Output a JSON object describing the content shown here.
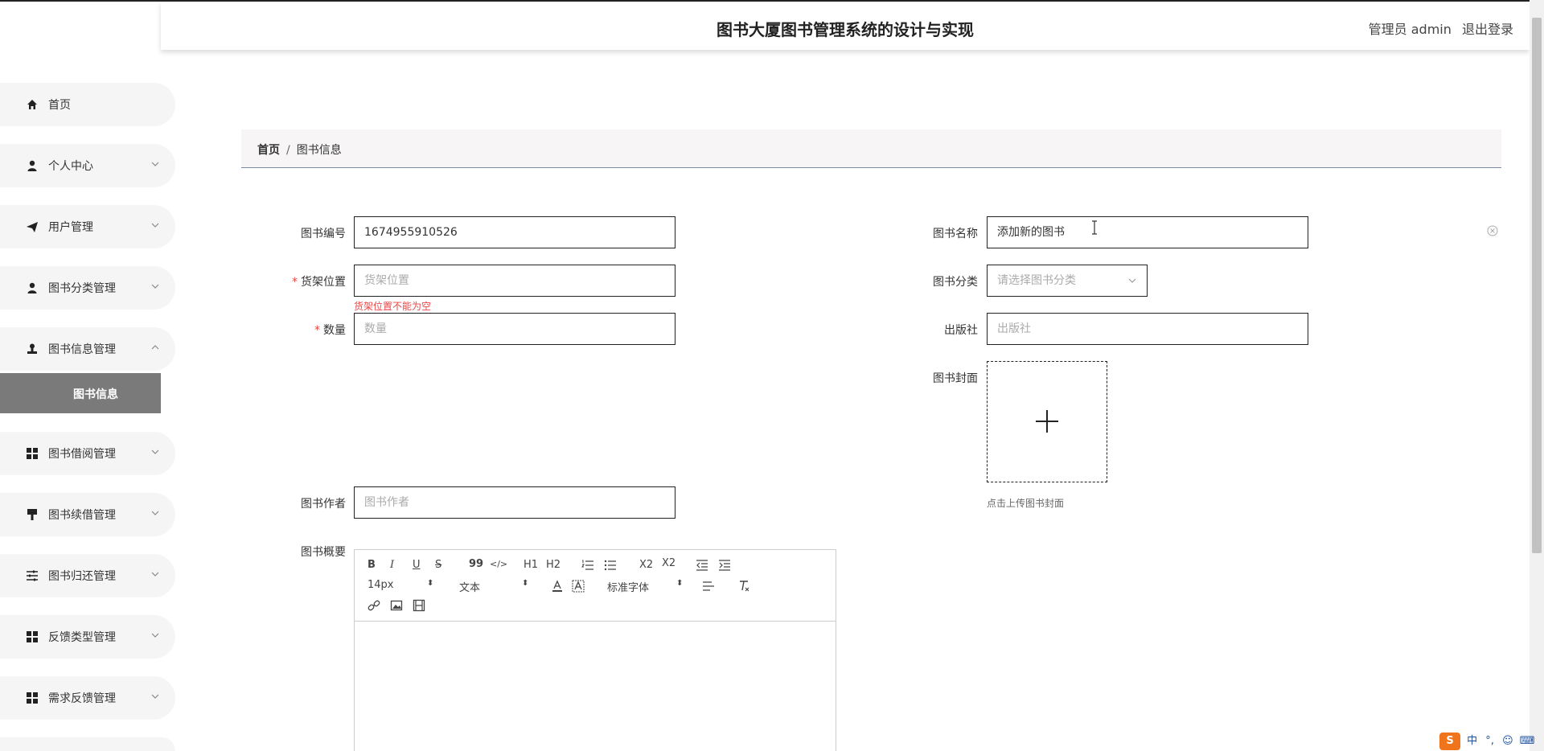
{
  "header": {
    "title": "图书大厦图书管理系统的设计与实现",
    "user_label": "管理员 admin",
    "logout_label": "退出登录"
  },
  "sidebar": {
    "items": [
      {
        "label": "首页",
        "icon": "home-icon"
      },
      {
        "label": "个人中心",
        "icon": "person-icon"
      },
      {
        "label": "用户管理",
        "icon": "send-icon"
      },
      {
        "label": "图书分类管理",
        "icon": "person-icon"
      },
      {
        "label": "图书信息管理",
        "icon": "stamp-icon"
      },
      {
        "label": "图书借阅管理",
        "icon": "grid-icon"
      },
      {
        "label": "图书续借管理",
        "icon": "brush-icon"
      },
      {
        "label": "图书归还管理",
        "icon": "sliders-icon"
      },
      {
        "label": "反馈类型管理",
        "icon": "grid-icon"
      },
      {
        "label": "需求反馈管理",
        "icon": "grid-icon"
      }
    ],
    "active_sub": "图书信息"
  },
  "breadcrumb": {
    "home": "首页",
    "separator": "/",
    "current": "图书信息"
  },
  "form": {
    "book_no": {
      "label": "图书编号",
      "value": "1674955910526"
    },
    "book_name": {
      "label": "图书名称",
      "value": "添加新的图书"
    },
    "shelf": {
      "label": "货架位置",
      "placeholder": "货架位置",
      "error": "货架位置不能为空",
      "required": "*"
    },
    "category": {
      "label": "图书分类",
      "placeholder": "请选择图书分类"
    },
    "quantity": {
      "label": "数量",
      "placeholder": "数量",
      "required": "*"
    },
    "publisher": {
      "label": "出版社",
      "placeholder": "出版社"
    },
    "cover": {
      "label": "图书封面",
      "hint": "点击上传图书封面"
    },
    "author": {
      "label": "图书作者",
      "placeholder": "图书作者"
    },
    "summary": {
      "label": "图书概要"
    }
  },
  "editor": {
    "bold": "B",
    "italic": "I",
    "underline": "U",
    "strike": "S",
    "quote": "99",
    "code": "</>",
    "h1": "H1",
    "h2": "H2",
    "sub": "X2",
    "sup": "X2",
    "font_size": "14px",
    "text_type": "文本",
    "font_family": "标准字体"
  },
  "ime": {
    "mode": "中",
    "punct": "°,"
  },
  "colors": {
    "accent_error": "#e44444",
    "sidebar_active": "#7a7a7a"
  }
}
